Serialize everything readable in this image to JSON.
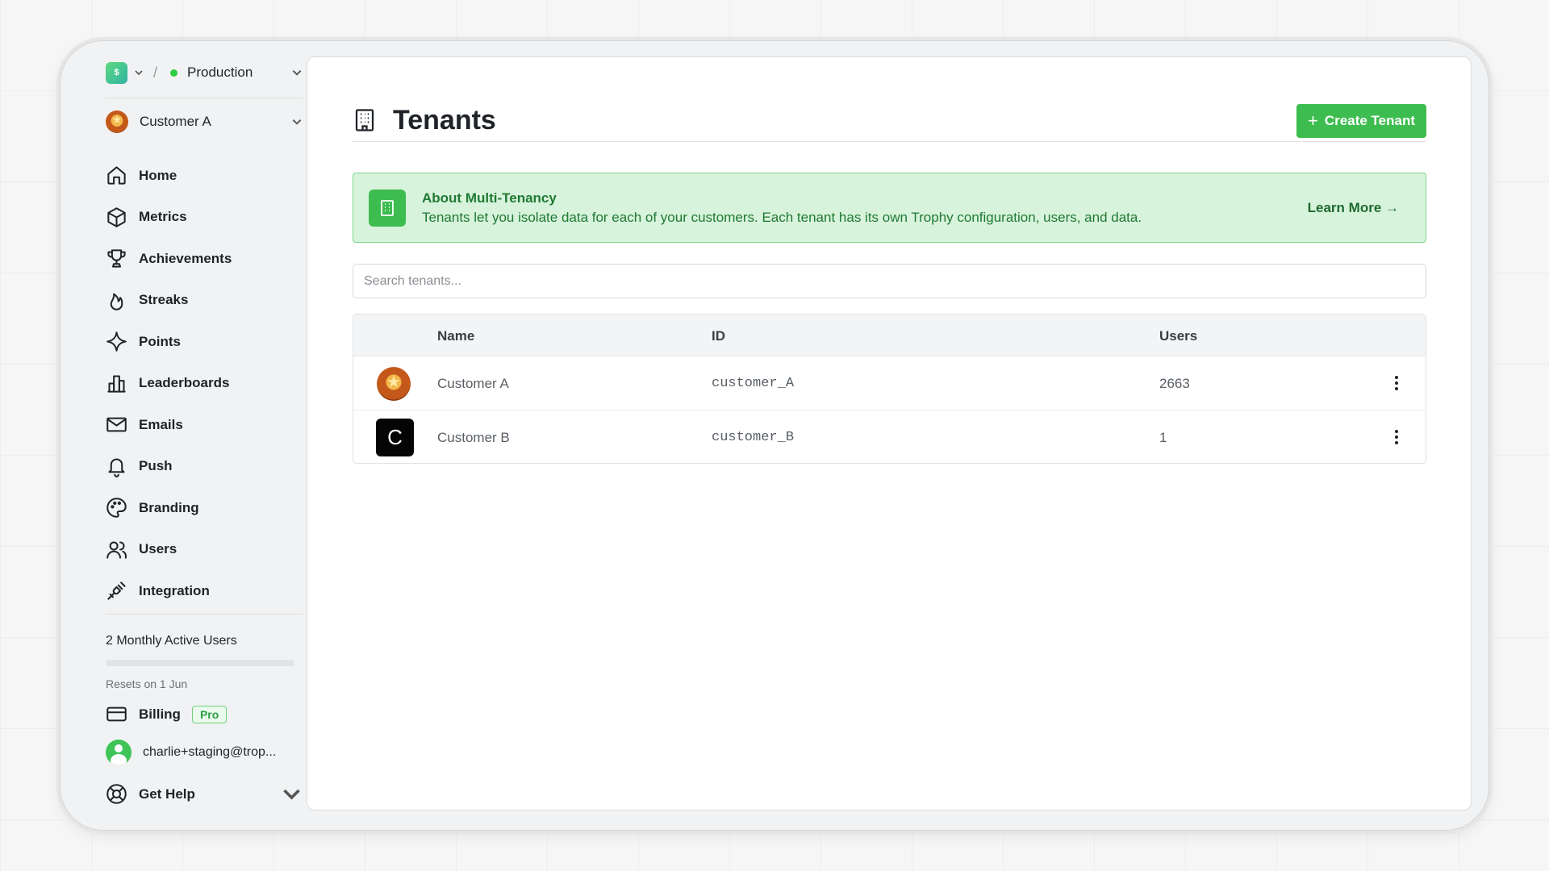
{
  "environment": {
    "logo_letter": "$",
    "name": "Production",
    "status_color": "#2ecc40"
  },
  "customer_switcher": {
    "name": "Customer A"
  },
  "sidebar": {
    "items": [
      {
        "label": "Home",
        "icon": "home-icon"
      },
      {
        "label": "Metrics",
        "icon": "cube-icon"
      },
      {
        "label": "Achievements",
        "icon": "trophy-icon"
      },
      {
        "label": "Streaks",
        "icon": "flame-icon"
      },
      {
        "label": "Points",
        "icon": "sparkle-icon"
      },
      {
        "label": "Leaderboards",
        "icon": "bar-chart-icon"
      },
      {
        "label": "Emails",
        "icon": "mail-icon"
      },
      {
        "label": "Push",
        "icon": "bell-icon"
      },
      {
        "label": "Branding",
        "icon": "palette-icon"
      },
      {
        "label": "Users",
        "icon": "users-icon"
      },
      {
        "label": "Integration",
        "icon": "plug-icon"
      }
    ],
    "mau": {
      "title": "2 Monthly Active Users",
      "reset": "Resets on 1 Jun",
      "usage_fraction": 0
    },
    "billing": {
      "label": "Billing",
      "badge": "Pro"
    },
    "user_email": "charlie+staging@trop...",
    "help": {
      "label": "Get Help"
    }
  },
  "page": {
    "title": "Tenants",
    "create_button": "Create Tenant",
    "info": {
      "title": "About Multi-Tenancy",
      "text": "Tenants let you isolate data for each of your customers. Each tenant has its own Trophy configuration, users, and data.",
      "link": "Learn More →"
    },
    "search": {
      "placeholder": "Search tenants..."
    },
    "table": {
      "columns": [
        "Name",
        "ID",
        "Users"
      ],
      "rows": [
        {
          "name": "Customer A",
          "id": "customer_A",
          "users": "2663",
          "logo": "badge"
        },
        {
          "name": "Customer B",
          "id": "customer_B",
          "users": "1",
          "logo_letter": "C"
        }
      ]
    }
  },
  "colors": {
    "accent": "#3dbd4f",
    "info_bg": "#d8f3dc",
    "info_text": "#1f7a33"
  }
}
